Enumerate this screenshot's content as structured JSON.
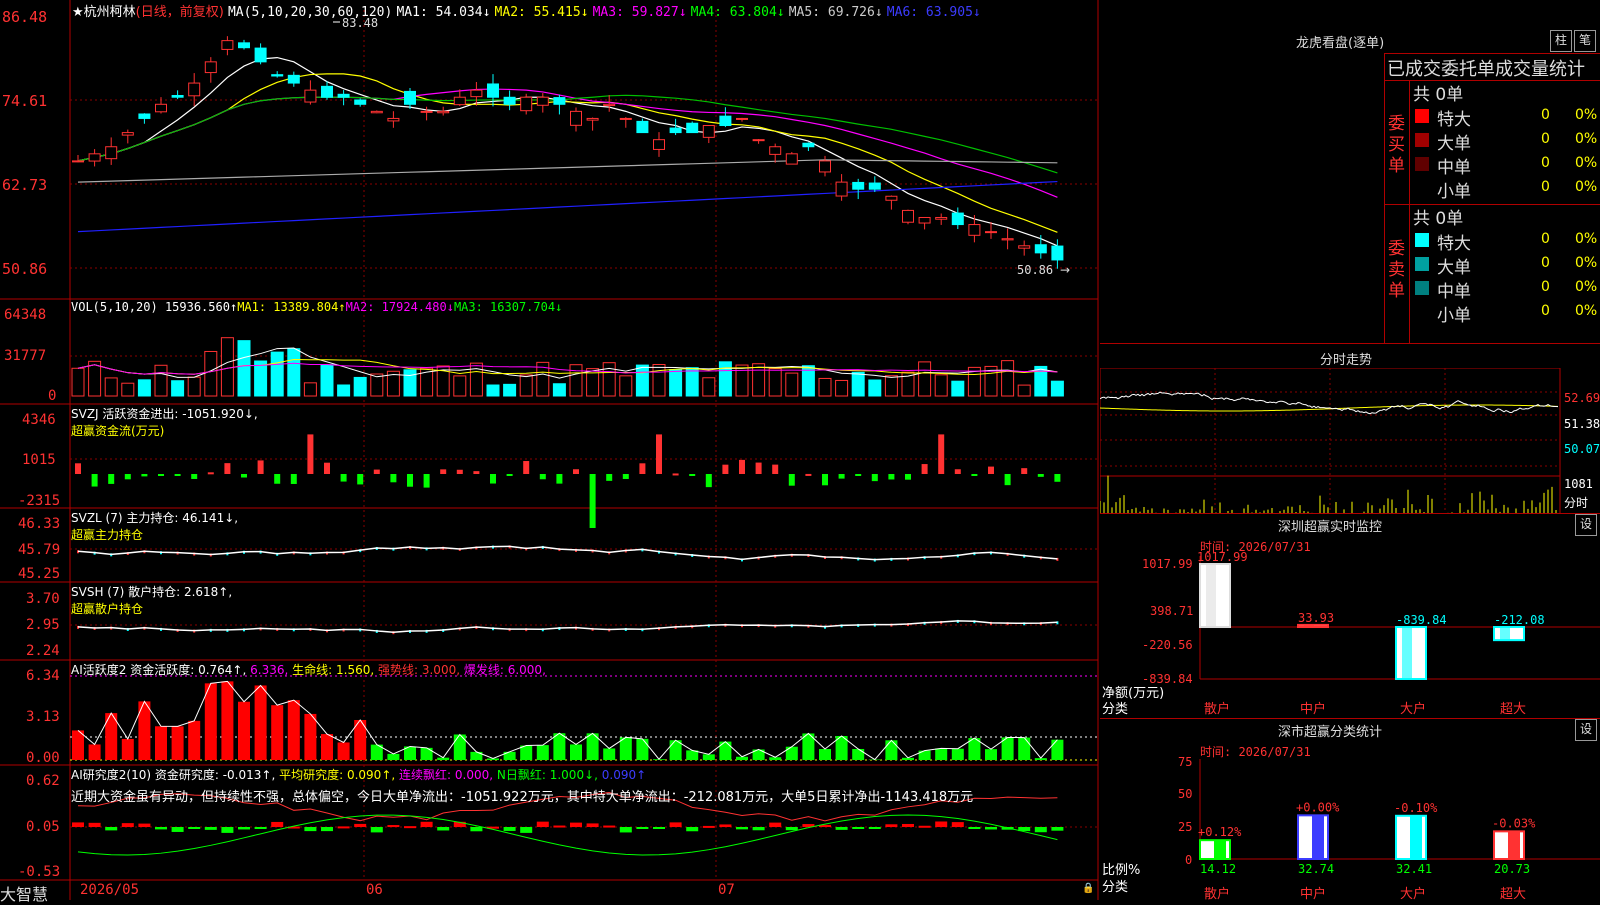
{
  "header": {
    "star": "★",
    "stock_name": "杭州柯林",
    "mode": "(日线，前复权)",
    "ma_title": "MA(5,10,20,30,60,120)",
    "ma": [
      {
        "label": "MA1: 54.034↓",
        "color": "#ffffff"
      },
      {
        "label": "MA2: 55.415↓",
        "color": "#ffff00"
      },
      {
        "label": "MA3: 59.827↓",
        "color": "#ff00ff"
      },
      {
        "label": "MA4: 63.804↓",
        "color": "#00ff00"
      },
      {
        "label": "MA5: 69.726↓",
        "color": "#cccccc"
      },
      {
        "label": "MA6: 63.905↓",
        "color": "#2b2bff"
      }
    ],
    "max_label": "83.48",
    "min_label": "50.86"
  },
  "kline_axis": [
    "86.48",
    "74.61",
    "62.73",
    "50.86"
  ],
  "vol": {
    "title": "VOL(5,10,20)",
    "value": "15936.560↑",
    "ma1": "MA1: 13389.804↑",
    "ma2": "MA2: 17924.480↓",
    "ma3": "MA3: 16307.704↓",
    "axis": [
      "64348",
      "31777",
      "0"
    ]
  },
  "svzj": {
    "title": "SVZJ  活跃资金进出: -1051.920↓,",
    "sub": "超赢资金流(万元)",
    "axis": [
      "4346",
      "1015",
      "-2315"
    ]
  },
  "svzl": {
    "title": "SVZL (7) 主力持仓: 46.141↓,",
    "sub": "超赢主力持仓",
    "axis": [
      "46.33",
      "45.79",
      "45.25"
    ]
  },
  "svsh": {
    "title": "SVSH (7) 散户持仓: 2.618↑,",
    "sub": "超赢散户持仓",
    "axis": [
      "3.70",
      "2.95",
      "2.24"
    ]
  },
  "ai_active": {
    "title": "AI活跃度2",
    "v1": "资金活跃度: 0.764↑,",
    "v2": "6.336,",
    "v3": "生命线: 1.560,",
    "v4": "强势线: 3.000,",
    "v5": "爆发线: 6.000,",
    "axis": [
      "6.34",
      "3.13",
      "0.00"
    ]
  },
  "ai_research": {
    "title": "AI研究度2(10)",
    "v1": "资金研究度: -0.013↑,",
    "v2": "平均研究度: 0.090↑,",
    "v3": "连续飘红: 0.000,",
    "v4": "N日飘红: 1.000↓,",
    "v5": "0.090↑",
    "comment": "近期大资金虽有异动，但持续性不强，总体偏空，今日大单净流出：-1051.922万元，其中特大单净流出：-212.081万元，大单5日累计净出-1143.418万元",
    "axis": [
      "0.62",
      "0.05",
      "-0.53"
    ]
  },
  "xaxis": {
    "brand": "大智慧",
    "labels": [
      "2026/05",
      "06",
      "07"
    ]
  },
  "panel_lhb": {
    "title": "龙虎看盘(逐单)",
    "btn1": "柱",
    "btn2": "笔",
    "subtitle": "已成交委托单成交量统计",
    "buy_label": "委买单",
    "sell_label": "委卖单",
    "buy_total": "共 0单",
    "sell_total": "共 0单",
    "buy_rows": [
      {
        "name": "特大",
        "vol": "0",
        "pct": "0%",
        "color": "#ff0000"
      },
      {
        "name": "大单",
        "vol": "0",
        "pct": "0%",
        "color": "#a00000"
      },
      {
        "name": "中单",
        "vol": "0",
        "pct": "0%",
        "color": "#600000"
      },
      {
        "name": "小单",
        "vol": "0",
        "pct": "0%",
        "color": "#000000"
      }
    ],
    "sell_rows": [
      {
        "name": "特大",
        "vol": "0",
        "pct": "0%",
        "color": "#00ffff"
      },
      {
        "name": "大单",
        "vol": "0",
        "pct": "0%",
        "color": "#00a0a0"
      },
      {
        "name": "中单",
        "vol": "0",
        "pct": "0%",
        "color": "#008080"
      },
      {
        "name": "小单",
        "vol": "0",
        "pct": "0%",
        "color": "#000000"
      }
    ]
  },
  "panel_fs": {
    "title": "分时走势",
    "axis": [
      "52.69",
      "51.38",
      "50.07"
    ],
    "vol_top": "1081",
    "vol_label": "分时"
  },
  "panel_monitor": {
    "title": "深圳超赢实时监控",
    "btn": "设",
    "time": "时间: 2026/07/31",
    "axis": [
      "1017.99",
      "398.71",
      "-220.56",
      "-839.84"
    ],
    "ylabel1": "净额(万元)",
    "ylabel2": "分类",
    "cats": [
      "散户",
      "中户",
      "大户",
      "超大"
    ],
    "values": [
      "1017.99",
      "33.93",
      "-839.84",
      "-212.08"
    ]
  },
  "panel_class": {
    "title": "深市超赢分类统计",
    "btn": "设",
    "time": "时间: 2026/07/31",
    "axis": [
      "75",
      "50",
      "25",
      "0"
    ],
    "ylabel1": "比例%",
    "ylabel2": "分类",
    "cats": [
      "散户",
      "中户",
      "大户",
      "超大"
    ],
    "changes": [
      "+0.12%",
      "+0.00%",
      "-0.10%",
      "-0.03%"
    ],
    "values": [
      "14.12",
      "32.74",
      "32.41",
      "20.73"
    ]
  },
  "chart_data": [
    {
      "type": "bar",
      "title": "深圳超赢实时监控",
      "ylabel": "净额(万元)",
      "categories": [
        "散户",
        "中户",
        "大户",
        "超大"
      ],
      "values": [
        1017.99,
        33.93,
        -839.84,
        -212.08
      ],
      "ylim": [
        -839.84,
        1017.99
      ]
    },
    {
      "type": "bar",
      "title": "深市超赢分类统计",
      "ylabel": "比例%",
      "categories": [
        "散户",
        "中户",
        "大户",
        "超大"
      ],
      "values": [
        14.12,
        32.74,
        32.41,
        20.73
      ],
      "ylim": [
        0,
        75
      ]
    }
  ],
  "colors": {
    "up": "#ff3232",
    "down": "#00ffff",
    "frame": "#b00000",
    "text_red": "#ff3232",
    "ma_white": "#ffffff",
    "ma_yellow": "#ffff00",
    "ma_magenta": "#ff00ff",
    "ma_green": "#00c000",
    "ma_gray": "#aaaaaa",
    "ma_blue": "#2020ff"
  }
}
